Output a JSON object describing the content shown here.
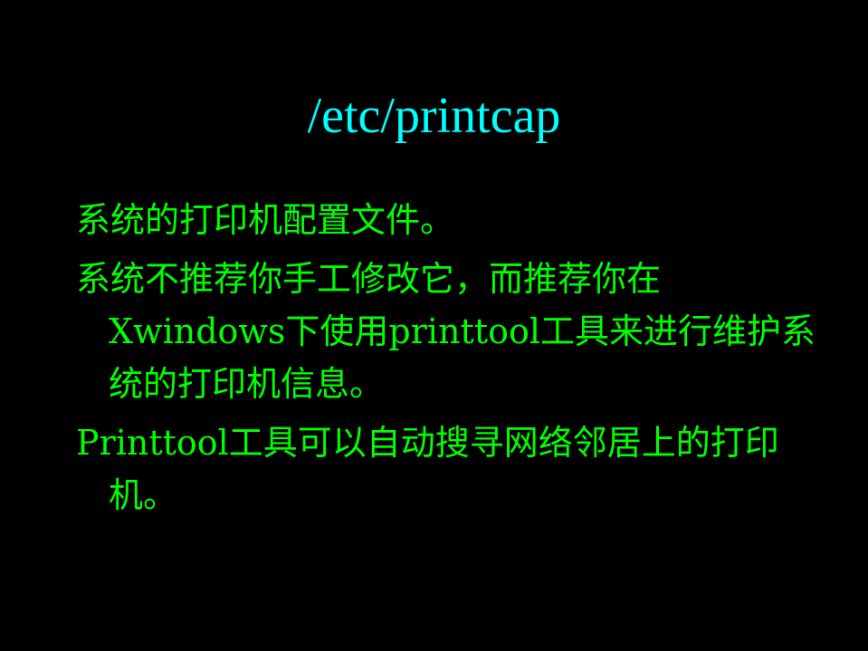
{
  "slide": {
    "title": "/etc/printcap",
    "bullets": [
      "系统的打印机配置文件。",
      "系统不推荐你手工修改它，而推荐你在Xwindows下使用printtool工具来进行维护系统的打印机信息。",
      "Printtool工具可以自动搜寻网络邻居上的打印机。"
    ]
  },
  "colors": {
    "background": "#000000",
    "title": "#00ffff",
    "body_text": "#00ff00"
  }
}
